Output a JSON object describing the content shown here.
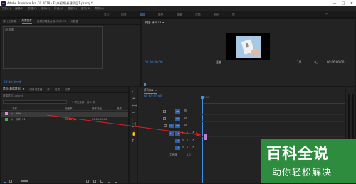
{
  "window": {
    "app_icon": "Pr",
    "title": "Adobe Premiere Pro CC 2018 - F:\\来视频\\新建项目1.prproj *",
    "min": "—",
    "max": "□",
    "close": "✕"
  },
  "menu": [
    "文件(F)",
    "编辑(E)",
    "剪辑(C)",
    "序列(S)",
    "标记(M)",
    "图形(G)",
    "窗口(W)",
    "帮助(H)"
  ],
  "workspaces": [
    "学习",
    "组件",
    "编辑",
    "颜色",
    "效果",
    "音频",
    "图形",
    "库"
  ],
  "workspace_more": "»",
  "source": {
    "tabs": [
      "源: (无剪辑)",
      "效果控件",
      "音频剪辑混合器: 序列 01",
      "元数据"
    ],
    "rows": [
      "(无剪辑)",
      "(无剪辑)"
    ],
    "timecode": "00:00:00:00"
  },
  "program": {
    "title": "节目: 序列 01 ≡",
    "timecode_left": "00:00:00:00",
    "fit": "适合",
    "zoom": "1/2",
    "timecode_right": "00:00:00:00",
    "transport": [
      "{",
      "}",
      "|←",
      "◀|",
      "▶",
      "|▶",
      "→|",
      "⊞",
      "⊟",
      "📷",
      "+"
    ]
  },
  "project": {
    "tabs": [
      "项目: 新建项目1 ≡",
      "媒体浏览器",
      "库",
      "信息",
      "效果"
    ],
    "project_file": "新建项目1.prproj",
    "item_count": "1 项已选择，共 2 项",
    "columns": [
      "名称",
      "帧速率",
      "媒体开始",
      "媒体"
    ],
    "rows": [
      {
        "name": "title",
        "fps": "",
        "start": "",
        "color": "#e08ad8",
        "selected": true
      },
      {
        "name": "序列 01",
        "fps": "25.00 fps",
        "start": "00:00:00:00",
        "color": "#3fb24a",
        "selected": false
      }
    ]
  },
  "tools": [
    "▸",
    "⇥",
    "⟺",
    "✂",
    "|↔|",
    "✒",
    "✋",
    "T"
  ],
  "timeline": {
    "title": "序列 01 ≡",
    "timecode": "00:00:00:00",
    "ruler_label": "00:00",
    "tracks": [
      {
        "name": "V3",
        "src": "",
        "type": "video"
      },
      {
        "name": "V2",
        "src": "",
        "type": "video"
      },
      {
        "name": "V1",
        "src": "V1",
        "type": "video"
      },
      {
        "name": "A1",
        "src": "A1",
        "type": "audio"
      },
      {
        "name": "A2",
        "src": "",
        "type": "audio"
      },
      {
        "name": "A3",
        "src": "",
        "type": "audio"
      },
      {
        "name": "主声道",
        "src": "",
        "type": "master",
        "level": "0.0"
      }
    ],
    "track_controls": {
      "eye": "👁",
      "m": "M",
      "s": "S",
      "mic": "🎤",
      "fx": "fx"
    }
  },
  "watermark": {
    "title": "百科全说",
    "subtitle": "助你轻松解决"
  },
  "colors": {
    "accent": "#3c8ee8",
    "title_clip": "#c37bd6",
    "sequence": "#3fb24a",
    "arrow": "#e02020",
    "watermark_bg": "#2d8c3e"
  }
}
